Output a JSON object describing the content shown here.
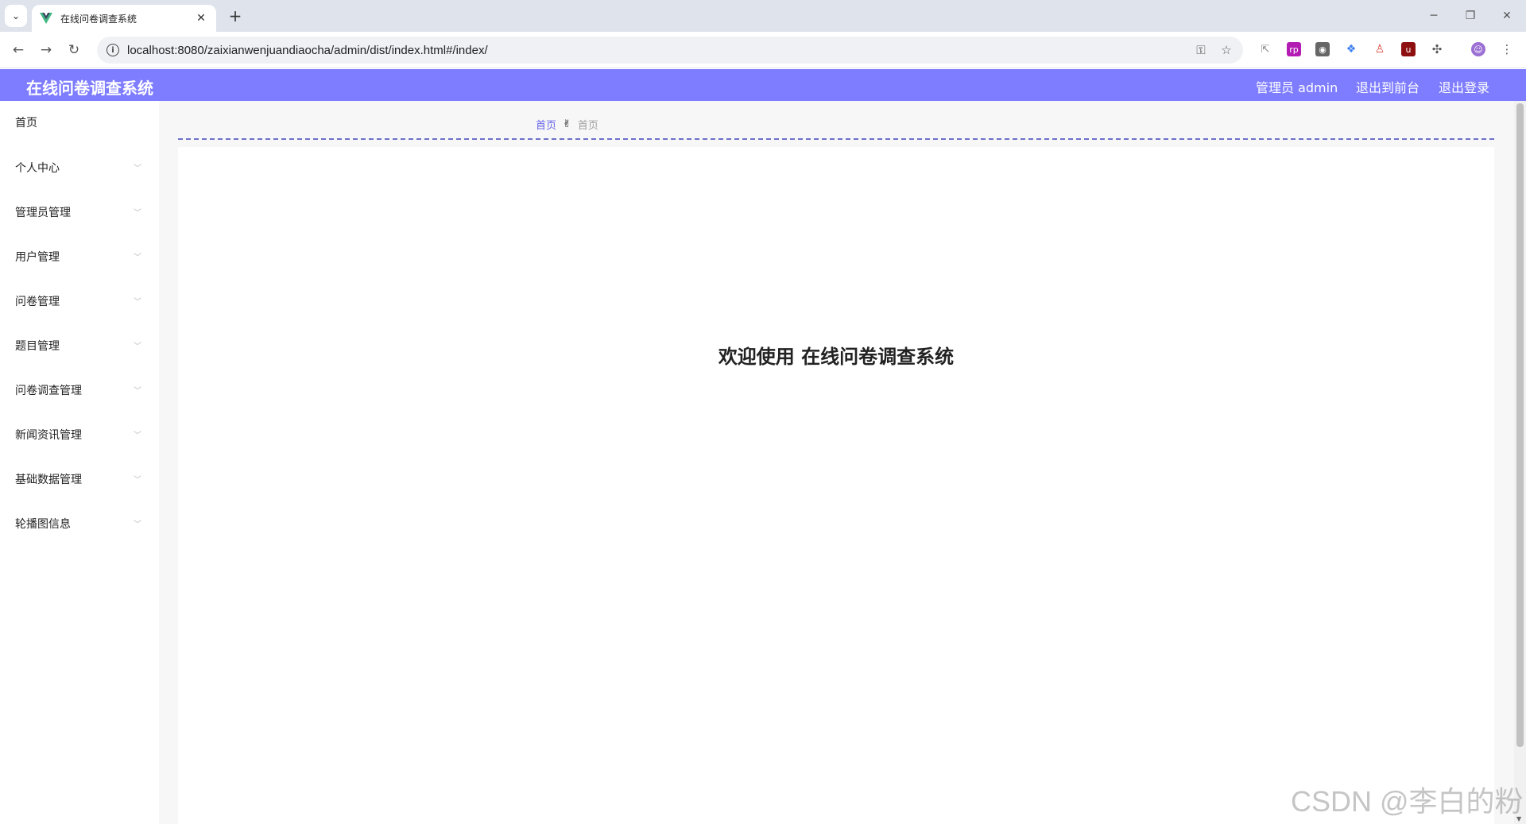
{
  "browser": {
    "tab_title": "在线问卷调查系统",
    "tab_close": "✕",
    "new_tab": "+",
    "url": "localhost:8080/zaixianwenjuandiaocha/admin/dist/index.html#/index/"
  },
  "header": {
    "title": "在线问卷调查系统",
    "user_label": "管理员 admin",
    "to_front_label": "退出到前台",
    "logout_label": "退出登录"
  },
  "sidebar": {
    "items": [
      {
        "label": "首页",
        "has_arrow": false
      },
      {
        "label": "个人中心",
        "has_arrow": true
      },
      {
        "label": "管理员管理",
        "has_arrow": true
      },
      {
        "label": "用户管理",
        "has_arrow": true
      },
      {
        "label": "问卷管理",
        "has_arrow": true
      },
      {
        "label": "题目管理",
        "has_arrow": true
      },
      {
        "label": "问卷调查管理",
        "has_arrow": true
      },
      {
        "label": "新闻资讯管理",
        "has_arrow": true
      },
      {
        "label": "基础数据管理",
        "has_arrow": true
      },
      {
        "label": "轮播图信息",
        "has_arrow": true
      }
    ]
  },
  "breadcrumb": {
    "home": "首页",
    "separator": "✌",
    "current": "首页"
  },
  "main": {
    "welcome": "欢迎使用 在线问卷调查系统"
  },
  "watermark": "CSDN @李白的粉",
  "colors": {
    "header_bg": "#7e7cff",
    "breadcrumb_home": "#6764e8"
  }
}
